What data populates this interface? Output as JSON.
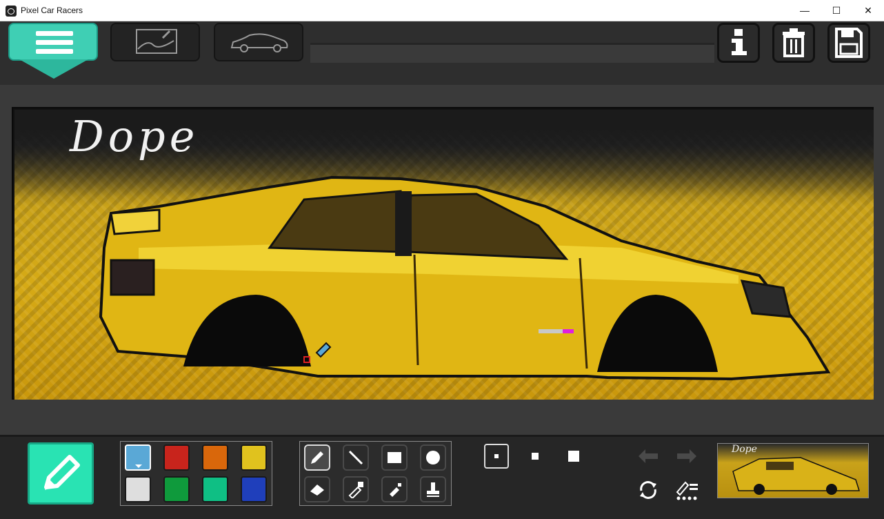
{
  "window": {
    "title": "Pixel Car Racers",
    "minimize_icon": "minimize-icon",
    "maximize_icon": "maximize-icon",
    "close_icon": "close-icon",
    "minimize_glyph": "—",
    "maximize_glyph": "☐",
    "close_glyph": "✕"
  },
  "topbar": {
    "menu_icon": "hamburger-menu-icon",
    "tabs": [
      {
        "name": "livery-editor-tab",
        "icon": "picture-pencil-icon"
      },
      {
        "name": "car-view-tab",
        "icon": "car-outline-icon"
      }
    ],
    "actions": [
      {
        "name": "info-button",
        "icon": "info-icon"
      },
      {
        "name": "delete-button",
        "icon": "trash-icon"
      },
      {
        "name": "save-button",
        "icon": "floppy-disk-icon"
      }
    ]
  },
  "canvas": {
    "signature": "Dope"
  },
  "colors": {
    "accent": "#29e3b3",
    "palette": [
      "#5aa8d6",
      "#c8241c",
      "#d9670b",
      "#e0c21e",
      "#dedede",
      "#0f9a3c",
      "#0fbf84",
      "#1f3fbb"
    ],
    "selected_palette_index": 0
  },
  "tools": [
    {
      "name": "pencil-tool",
      "icon": "pencil-icon",
      "selected": true
    },
    {
      "name": "line-tool",
      "icon": "line-icon",
      "selected": false
    },
    {
      "name": "rectangle-tool",
      "icon": "rectangle-icon",
      "selected": false
    },
    {
      "name": "circle-tool",
      "icon": "circle-icon",
      "selected": false
    },
    {
      "name": "eraser-tool",
      "icon": "eraser-icon",
      "selected": false
    },
    {
      "name": "eyedropper-tool",
      "icon": "eyedropper-icon",
      "selected": false
    },
    {
      "name": "spray-tool",
      "icon": "spray-can-icon",
      "selected": false
    },
    {
      "name": "stamp-tool",
      "icon": "stamp-icon",
      "selected": false
    }
  ],
  "brush_sizes": [
    "small",
    "medium",
    "large"
  ],
  "selected_brush_size": 0,
  "history": {
    "undo_icon": "undo-arrow-icon",
    "redo_icon": "redo-arrow-icon",
    "refresh_icon": "refresh-icon",
    "fill_icon": "pattern-fill-icon"
  },
  "preview": {
    "signature": "Dope"
  }
}
